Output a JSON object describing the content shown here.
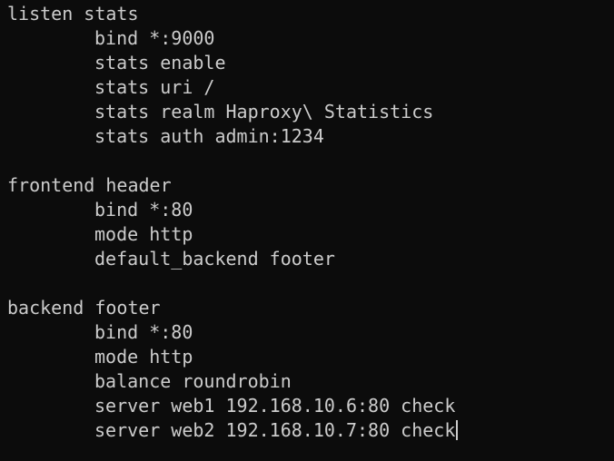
{
  "terminal": {
    "lines": [
      {
        "text": "listen stats",
        "indent": false
      },
      {
        "text": "bind *:9000",
        "indent": true
      },
      {
        "text": "stats enable",
        "indent": true
      },
      {
        "text": "stats uri /",
        "indent": true
      },
      {
        "text": "stats realm Haproxy\\ Statistics",
        "indent": true
      },
      {
        "text": "stats auth admin:1234",
        "indent": true
      },
      {
        "text": "",
        "indent": false
      },
      {
        "text": "frontend header",
        "indent": false
      },
      {
        "text": "bind *:80",
        "indent": true
      },
      {
        "text": "mode http",
        "indent": true
      },
      {
        "text": "default_backend footer",
        "indent": true
      },
      {
        "text": "",
        "indent": false
      },
      {
        "text": "backend footer",
        "indent": false
      },
      {
        "text": "bind *:80",
        "indent": true
      },
      {
        "text": "mode http",
        "indent": true
      },
      {
        "text": "balance roundrobin",
        "indent": true
      },
      {
        "text": "server web1 192.168.10.6:80 check",
        "indent": true
      },
      {
        "text": "server web2 192.168.10.7:80 check",
        "indent": true
      }
    ],
    "colors": {
      "background": "#0c0c0c",
      "foreground": "#cccccc"
    }
  }
}
